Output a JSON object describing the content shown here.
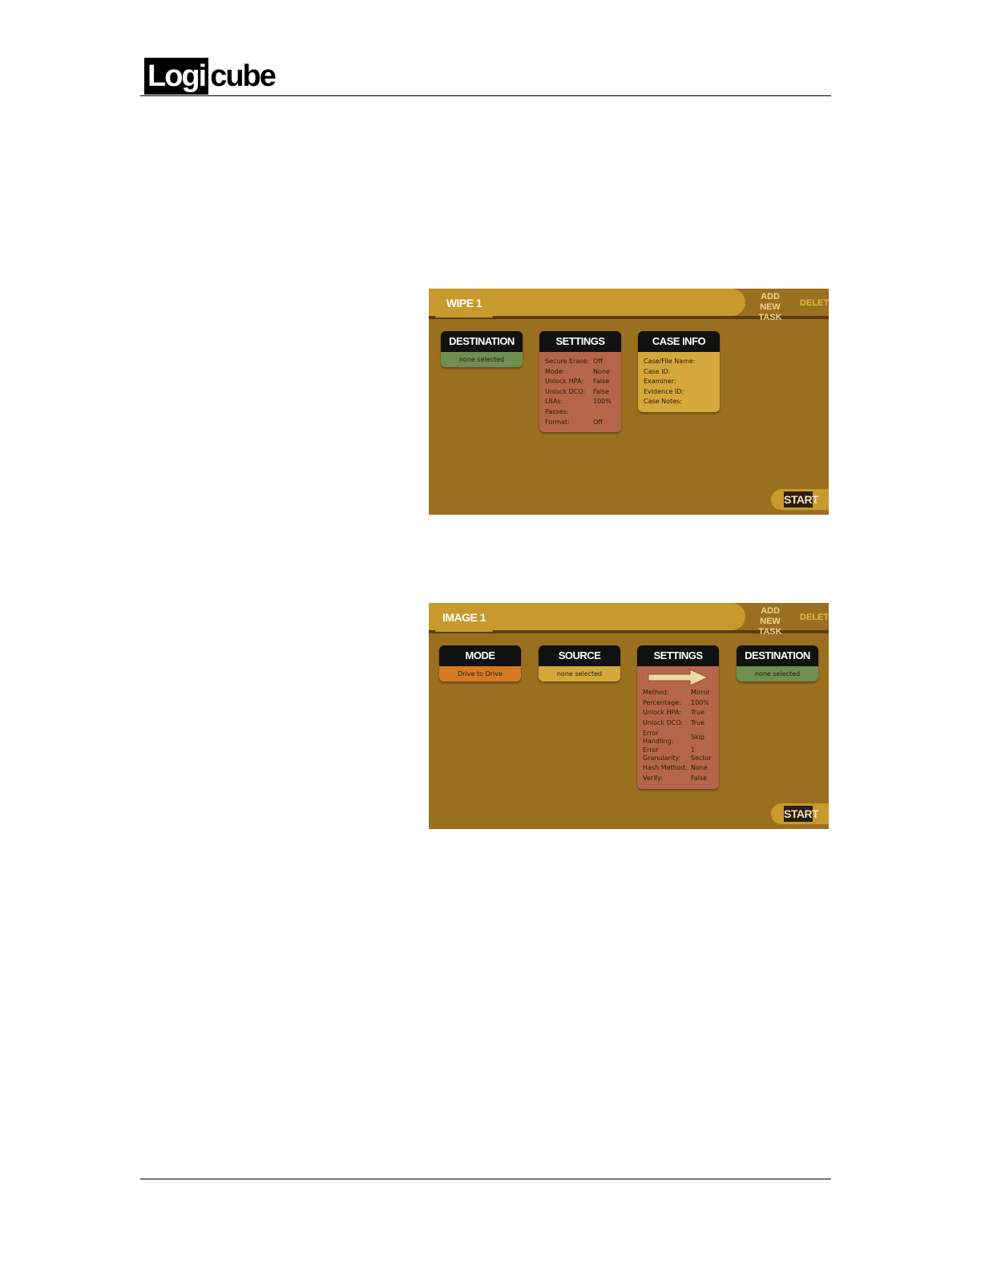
{
  "logo": {
    "box": "Logi",
    "rest": "cube"
  },
  "wipe": {
    "tab": "WIPE 1",
    "add_new": "ADD NEW TASK",
    "delete": "DELETE",
    "start": "START",
    "destination": {
      "title": "DESTINATION",
      "value": "none selected"
    },
    "settings": {
      "title": "SETTINGS",
      "rows": [
        {
          "k": "Secure Erase:",
          "v": "Off"
        },
        {
          "k": "Mode:",
          "v": "None"
        },
        {
          "k": "Unlock HPA:",
          "v": "False"
        },
        {
          "k": "Unlock DCO:",
          "v": "False"
        },
        {
          "k": "LBAs:",
          "v": "100%"
        },
        {
          "k": "Passes:",
          "v": ""
        },
        {
          "k": "Format:",
          "v": "Off"
        }
      ]
    },
    "case_info": {
      "title": "CASE INFO",
      "rows": [
        "Case/File Name:",
        "Case ID:",
        "Examiner:",
        "Evidence ID:",
        "Case Notes:"
      ]
    }
  },
  "image": {
    "tab": "IMAGE 1",
    "add_new": "ADD NEW TASK",
    "delete": "DELETE",
    "start": "START",
    "mode": {
      "title": "MODE",
      "value": "Drive to Drive"
    },
    "source": {
      "title": "SOURCE",
      "value": "none selected"
    },
    "settings": {
      "title": "SETTINGS",
      "rows": [
        {
          "k": "Method:",
          "v": "Mirror"
        },
        {
          "k": "Percentage:",
          "v": "100%"
        },
        {
          "k": "Unlock HPA:",
          "v": "True"
        },
        {
          "k": "Unlock DCO:",
          "v": "True"
        },
        {
          "k": "Error Handling:",
          "v": "Skip"
        },
        {
          "k": "Error Granularity:",
          "v": "1 Sector"
        },
        {
          "k": "Hash Method:",
          "v": "None"
        },
        {
          "k": "Verify:",
          "v": "False"
        }
      ]
    },
    "destination": {
      "title": "DESTINATION",
      "value": "none selected"
    }
  }
}
